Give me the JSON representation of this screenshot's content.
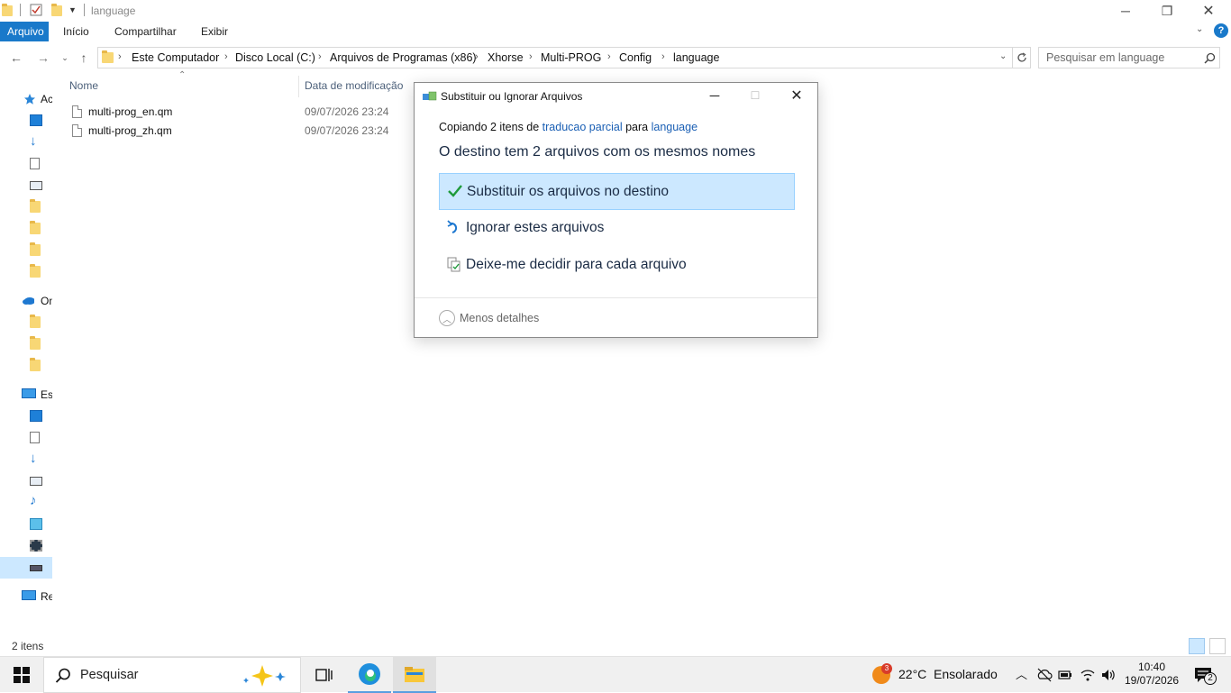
{
  "window": {
    "title": "language",
    "ribbon_tabs": [
      "Arquivo",
      "Início",
      "Compartilhar",
      "Exibir"
    ],
    "help_icon": "?"
  },
  "address": {
    "crumbs": [
      "Este Computador",
      "Disco Local (C:)",
      "Arquivos de Programas (x86)",
      "Xhorse",
      "Multi-PROG",
      "Config",
      "language"
    ],
    "search_placeholder": "Pesquisar em language"
  },
  "nav_pane": {
    "items": [
      {
        "label": "Ac",
        "icon": "star-icon"
      },
      {
        "label": "",
        "icon": "desktop-icon"
      },
      {
        "label": "",
        "icon": "download-icon"
      },
      {
        "label": "",
        "icon": "document-icon"
      },
      {
        "label": "",
        "icon": "picture-icon"
      },
      {
        "label": "",
        "icon": "folder-icon"
      },
      {
        "label": "",
        "icon": "folder-icon"
      },
      {
        "label": "",
        "icon": "folder-icon"
      },
      {
        "label": "",
        "icon": "folder-icon"
      },
      {
        "label": "On",
        "icon": "cloud-icon"
      },
      {
        "label": "",
        "icon": "folder-icon"
      },
      {
        "label": "",
        "icon": "folder-icon"
      },
      {
        "label": "",
        "icon": "folder-icon"
      },
      {
        "label": "Es",
        "icon": "computer-icon"
      },
      {
        "label": "",
        "icon": "desktop-icon"
      },
      {
        "label": "",
        "icon": "document-icon"
      },
      {
        "label": "",
        "icon": "download-icon"
      },
      {
        "label": "",
        "icon": "picture-icon"
      },
      {
        "label": "",
        "icon": "music-icon"
      },
      {
        "label": "",
        "icon": "cube-icon"
      },
      {
        "label": "",
        "icon": "video-icon"
      },
      {
        "label": "",
        "icon": "drive-icon"
      },
      {
        "label": "Re",
        "icon": "network-icon"
      }
    ]
  },
  "file_list": {
    "columns": [
      "Nome",
      "Data de modificação"
    ],
    "files": [
      {
        "name": "multi-prog_en.qm",
        "date": "09/07/2026 23:24"
      },
      {
        "name": "multi-prog_zh.qm",
        "date": "09/07/2026 23:24"
      }
    ]
  },
  "status": {
    "count": "2 itens"
  },
  "dialog": {
    "title": "Substituir ou Ignorar Arquivos",
    "copying_prefix": "Copiando 2 itens de ",
    "source": "traducao parcial",
    "copying_mid": " para ",
    "destination": "language",
    "message": "O destino tem 2 arquivos com os mesmos nomes",
    "options": [
      {
        "label": "Substituir os arquivos no destino",
        "icon": "checkmark-icon"
      },
      {
        "label": "Ignorar estes arquivos",
        "icon": "undo-arrow-icon"
      },
      {
        "label": "Deixe-me decidir para cada arquivo",
        "icon": "compare-files-icon"
      }
    ],
    "less_details": "Menos detalhes"
  },
  "taskbar": {
    "search_label": "Pesquisar",
    "weather_badge": "3",
    "temperature": "22°C",
    "weather": "Ensolarado",
    "time": "10:40",
    "date": "19/07/2026",
    "notif_count": "2"
  }
}
